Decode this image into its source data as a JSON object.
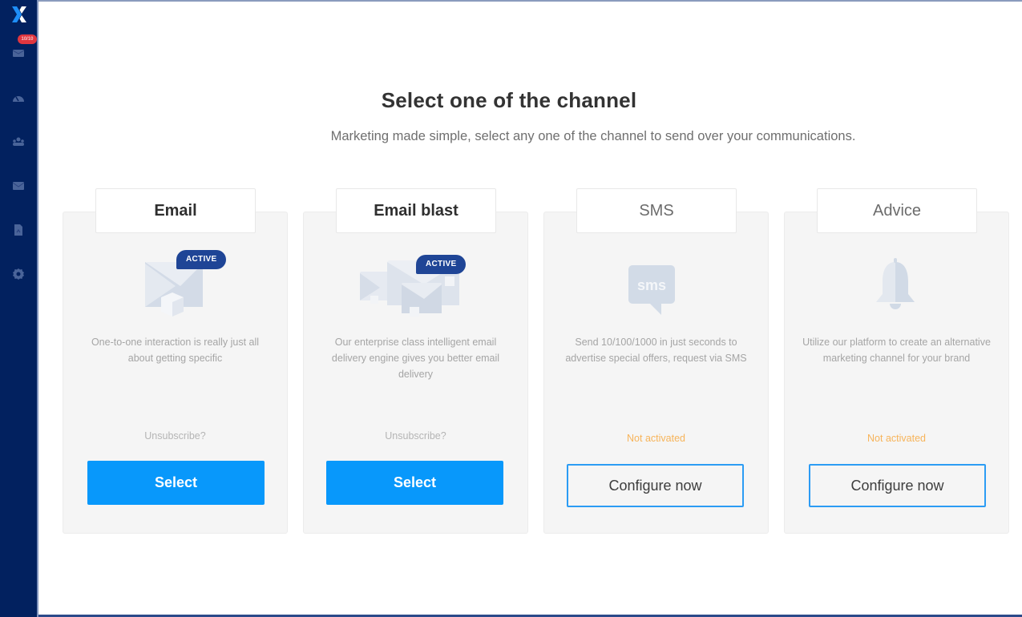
{
  "sidebar": {
    "logo": "x-logo-icon",
    "badge": "10/10",
    "items": [
      {
        "id": "campaigns",
        "icon": "envelope-stack-icon"
      },
      {
        "id": "dashboard",
        "icon": "gauge-icon"
      },
      {
        "id": "contacts",
        "icon": "users-icon"
      },
      {
        "id": "messages",
        "icon": "mail-icon"
      },
      {
        "id": "documents",
        "icon": "document-icon"
      },
      {
        "id": "settings",
        "icon": "gear-icon"
      }
    ]
  },
  "header": {
    "title": "Select one of the channel",
    "subtitle": "Marketing made simple, select any one of the channel to send over your communications."
  },
  "channels": [
    {
      "label": "Email",
      "badge": "ACTIVE",
      "icon": "email-icon",
      "description": "One-to-one interaction is really just all about getting specific",
      "status": "Unsubscribe?",
      "action": "Select"
    },
    {
      "label": "Email blast",
      "badge": "ACTIVE",
      "icon": "email-blast-icon",
      "description": "Our enterprise class intelligent email delivery engine gives you better email delivery",
      "status": "Unsubscribe?",
      "action": "Select"
    },
    {
      "label": "SMS",
      "icon": "sms-icon",
      "icon_text": "sms",
      "description": "Send 10/100/1000 in just seconds to advertise special offers, request via SMS",
      "status": "Not activated",
      "action": "Configure now"
    },
    {
      "label": "Advice",
      "icon": "bell-icon",
      "description": "Utilize our platform to create an alternative marketing channel for your brand",
      "status": "Not activated",
      "action": "Configure now"
    }
  ],
  "colors": {
    "sidebar": "#02215f",
    "primary": "#0898fb",
    "active_badge": "#1f4596",
    "warning": "#f7b45a"
  }
}
